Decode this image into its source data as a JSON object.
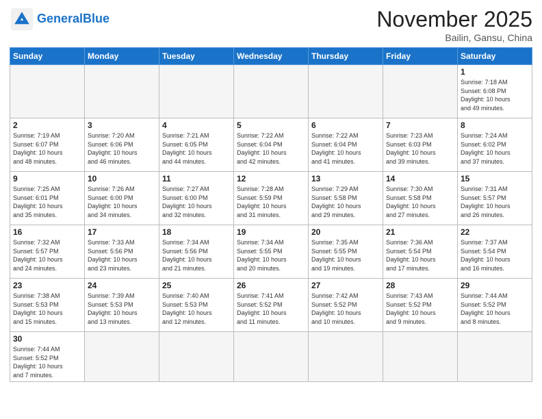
{
  "header": {
    "logo_general": "General",
    "logo_blue": "Blue",
    "month_title": "November 2025",
    "subtitle": "Bailin, Gansu, China"
  },
  "days_of_week": [
    "Sunday",
    "Monday",
    "Tuesday",
    "Wednesday",
    "Thursday",
    "Friday",
    "Saturday"
  ],
  "weeks": [
    [
      {
        "day": "",
        "info": "",
        "empty": true
      },
      {
        "day": "",
        "info": "",
        "empty": true
      },
      {
        "day": "",
        "info": "",
        "empty": true
      },
      {
        "day": "",
        "info": "",
        "empty": true
      },
      {
        "day": "",
        "info": "",
        "empty": true
      },
      {
        "day": "",
        "info": "",
        "empty": true
      },
      {
        "day": "1",
        "info": "Sunrise: 7:18 AM\nSunset: 6:08 PM\nDaylight: 10 hours\nand 49 minutes."
      }
    ],
    [
      {
        "day": "2",
        "info": "Sunrise: 7:19 AM\nSunset: 6:07 PM\nDaylight: 10 hours\nand 48 minutes."
      },
      {
        "day": "3",
        "info": "Sunrise: 7:20 AM\nSunset: 6:06 PM\nDaylight: 10 hours\nand 46 minutes."
      },
      {
        "day": "4",
        "info": "Sunrise: 7:21 AM\nSunset: 6:05 PM\nDaylight: 10 hours\nand 44 minutes."
      },
      {
        "day": "5",
        "info": "Sunrise: 7:22 AM\nSunset: 6:04 PM\nDaylight: 10 hours\nand 42 minutes."
      },
      {
        "day": "6",
        "info": "Sunrise: 7:22 AM\nSunset: 6:04 PM\nDaylight: 10 hours\nand 41 minutes."
      },
      {
        "day": "7",
        "info": "Sunrise: 7:23 AM\nSunset: 6:03 PM\nDaylight: 10 hours\nand 39 minutes."
      },
      {
        "day": "8",
        "info": "Sunrise: 7:24 AM\nSunset: 6:02 PM\nDaylight: 10 hours\nand 37 minutes."
      }
    ],
    [
      {
        "day": "9",
        "info": "Sunrise: 7:25 AM\nSunset: 6:01 PM\nDaylight: 10 hours\nand 35 minutes."
      },
      {
        "day": "10",
        "info": "Sunrise: 7:26 AM\nSunset: 6:00 PM\nDaylight: 10 hours\nand 34 minutes."
      },
      {
        "day": "11",
        "info": "Sunrise: 7:27 AM\nSunset: 6:00 PM\nDaylight: 10 hours\nand 32 minutes."
      },
      {
        "day": "12",
        "info": "Sunrise: 7:28 AM\nSunset: 5:59 PM\nDaylight: 10 hours\nand 31 minutes."
      },
      {
        "day": "13",
        "info": "Sunrise: 7:29 AM\nSunset: 5:58 PM\nDaylight: 10 hours\nand 29 minutes."
      },
      {
        "day": "14",
        "info": "Sunrise: 7:30 AM\nSunset: 5:58 PM\nDaylight: 10 hours\nand 27 minutes."
      },
      {
        "day": "15",
        "info": "Sunrise: 7:31 AM\nSunset: 5:57 PM\nDaylight: 10 hours\nand 26 minutes."
      }
    ],
    [
      {
        "day": "16",
        "info": "Sunrise: 7:32 AM\nSunset: 5:57 PM\nDaylight: 10 hours\nand 24 minutes."
      },
      {
        "day": "17",
        "info": "Sunrise: 7:33 AM\nSunset: 5:56 PM\nDaylight: 10 hours\nand 23 minutes."
      },
      {
        "day": "18",
        "info": "Sunrise: 7:34 AM\nSunset: 5:56 PM\nDaylight: 10 hours\nand 21 minutes."
      },
      {
        "day": "19",
        "info": "Sunrise: 7:34 AM\nSunset: 5:55 PM\nDaylight: 10 hours\nand 20 minutes."
      },
      {
        "day": "20",
        "info": "Sunrise: 7:35 AM\nSunset: 5:55 PM\nDaylight: 10 hours\nand 19 minutes."
      },
      {
        "day": "21",
        "info": "Sunrise: 7:36 AM\nSunset: 5:54 PM\nDaylight: 10 hours\nand 17 minutes."
      },
      {
        "day": "22",
        "info": "Sunrise: 7:37 AM\nSunset: 5:54 PM\nDaylight: 10 hours\nand 16 minutes."
      }
    ],
    [
      {
        "day": "23",
        "info": "Sunrise: 7:38 AM\nSunset: 5:53 PM\nDaylight: 10 hours\nand 15 minutes."
      },
      {
        "day": "24",
        "info": "Sunrise: 7:39 AM\nSunset: 5:53 PM\nDaylight: 10 hours\nand 13 minutes."
      },
      {
        "day": "25",
        "info": "Sunrise: 7:40 AM\nSunset: 5:53 PM\nDaylight: 10 hours\nand 12 minutes."
      },
      {
        "day": "26",
        "info": "Sunrise: 7:41 AM\nSunset: 5:52 PM\nDaylight: 10 hours\nand 11 minutes."
      },
      {
        "day": "27",
        "info": "Sunrise: 7:42 AM\nSunset: 5:52 PM\nDaylight: 10 hours\nand 10 minutes."
      },
      {
        "day": "28",
        "info": "Sunrise: 7:43 AM\nSunset: 5:52 PM\nDaylight: 10 hours\nand 9 minutes."
      },
      {
        "day": "29",
        "info": "Sunrise: 7:44 AM\nSunset: 5:52 PM\nDaylight: 10 hours\nand 8 minutes."
      }
    ],
    [
      {
        "day": "30",
        "info": "Sunrise: 7:44 AM\nSunset: 5:52 PM\nDaylight: 10 hours\nand 7 minutes.",
        "last": true
      },
      {
        "day": "",
        "info": "",
        "empty": true,
        "last": true
      },
      {
        "day": "",
        "info": "",
        "empty": true,
        "last": true
      },
      {
        "day": "",
        "info": "",
        "empty": true,
        "last": true
      },
      {
        "day": "",
        "info": "",
        "empty": true,
        "last": true
      },
      {
        "day": "",
        "info": "",
        "empty": true,
        "last": true
      },
      {
        "day": "",
        "info": "",
        "empty": true,
        "last": true
      }
    ]
  ]
}
